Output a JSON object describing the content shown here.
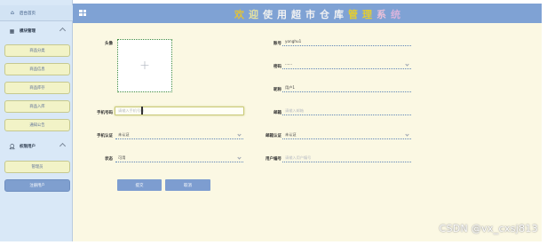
{
  "sidebar": {
    "home_label": "后台首页",
    "groups": [
      {
        "label": "模块管理",
        "items": [
          "商品分类",
          "商品信息",
          "商品库存",
          "商品入库",
          "通知公告"
        ]
      },
      {
        "label": "权限用户",
        "items": [
          "管理员",
          "注册用户"
        ]
      }
    ],
    "active_item": "注册用户"
  },
  "header": {
    "title_chars": [
      "欢",
      "迎",
      "使",
      "用",
      "超",
      "市",
      "仓",
      "库",
      "管",
      "理",
      "系",
      "统"
    ],
    "title_colors": [
      "#e0c23a",
      "#e8e4a0",
      "#eef0ee",
      "#f2f2f2",
      "#f2f2f2",
      "#f2f2f2",
      "#f2f2f2",
      "#f2f2f2",
      "#e3cd32",
      "#e3cd32",
      "#e8c0d8",
      "#d8b3dc"
    ]
  },
  "form": {
    "avatar_label": "头像",
    "upload_glyph": "+",
    "account": {
      "label": "账号",
      "value": "yonghu1"
    },
    "password": {
      "label": "密码",
      "value": "······"
    },
    "nickname": {
      "label": "昵称",
      "value": "用户1"
    },
    "phone": {
      "label": "手机号码",
      "placeholder": "请输入手机号码"
    },
    "email": {
      "label": "邮箱",
      "placeholder": "请输入邮箱"
    },
    "phone_verify": {
      "label": "手机认证",
      "value": "未认证"
    },
    "email_verify": {
      "label": "邮箱认证",
      "value": "未认证"
    },
    "status": {
      "label": "状态",
      "value": "可用"
    },
    "user_no": {
      "label": "用户编号",
      "placeholder": "请输入用户编号"
    },
    "submit_label": "提交",
    "cancel_label": "取消"
  },
  "watermark": "CSDN @vx_cxsj813"
}
